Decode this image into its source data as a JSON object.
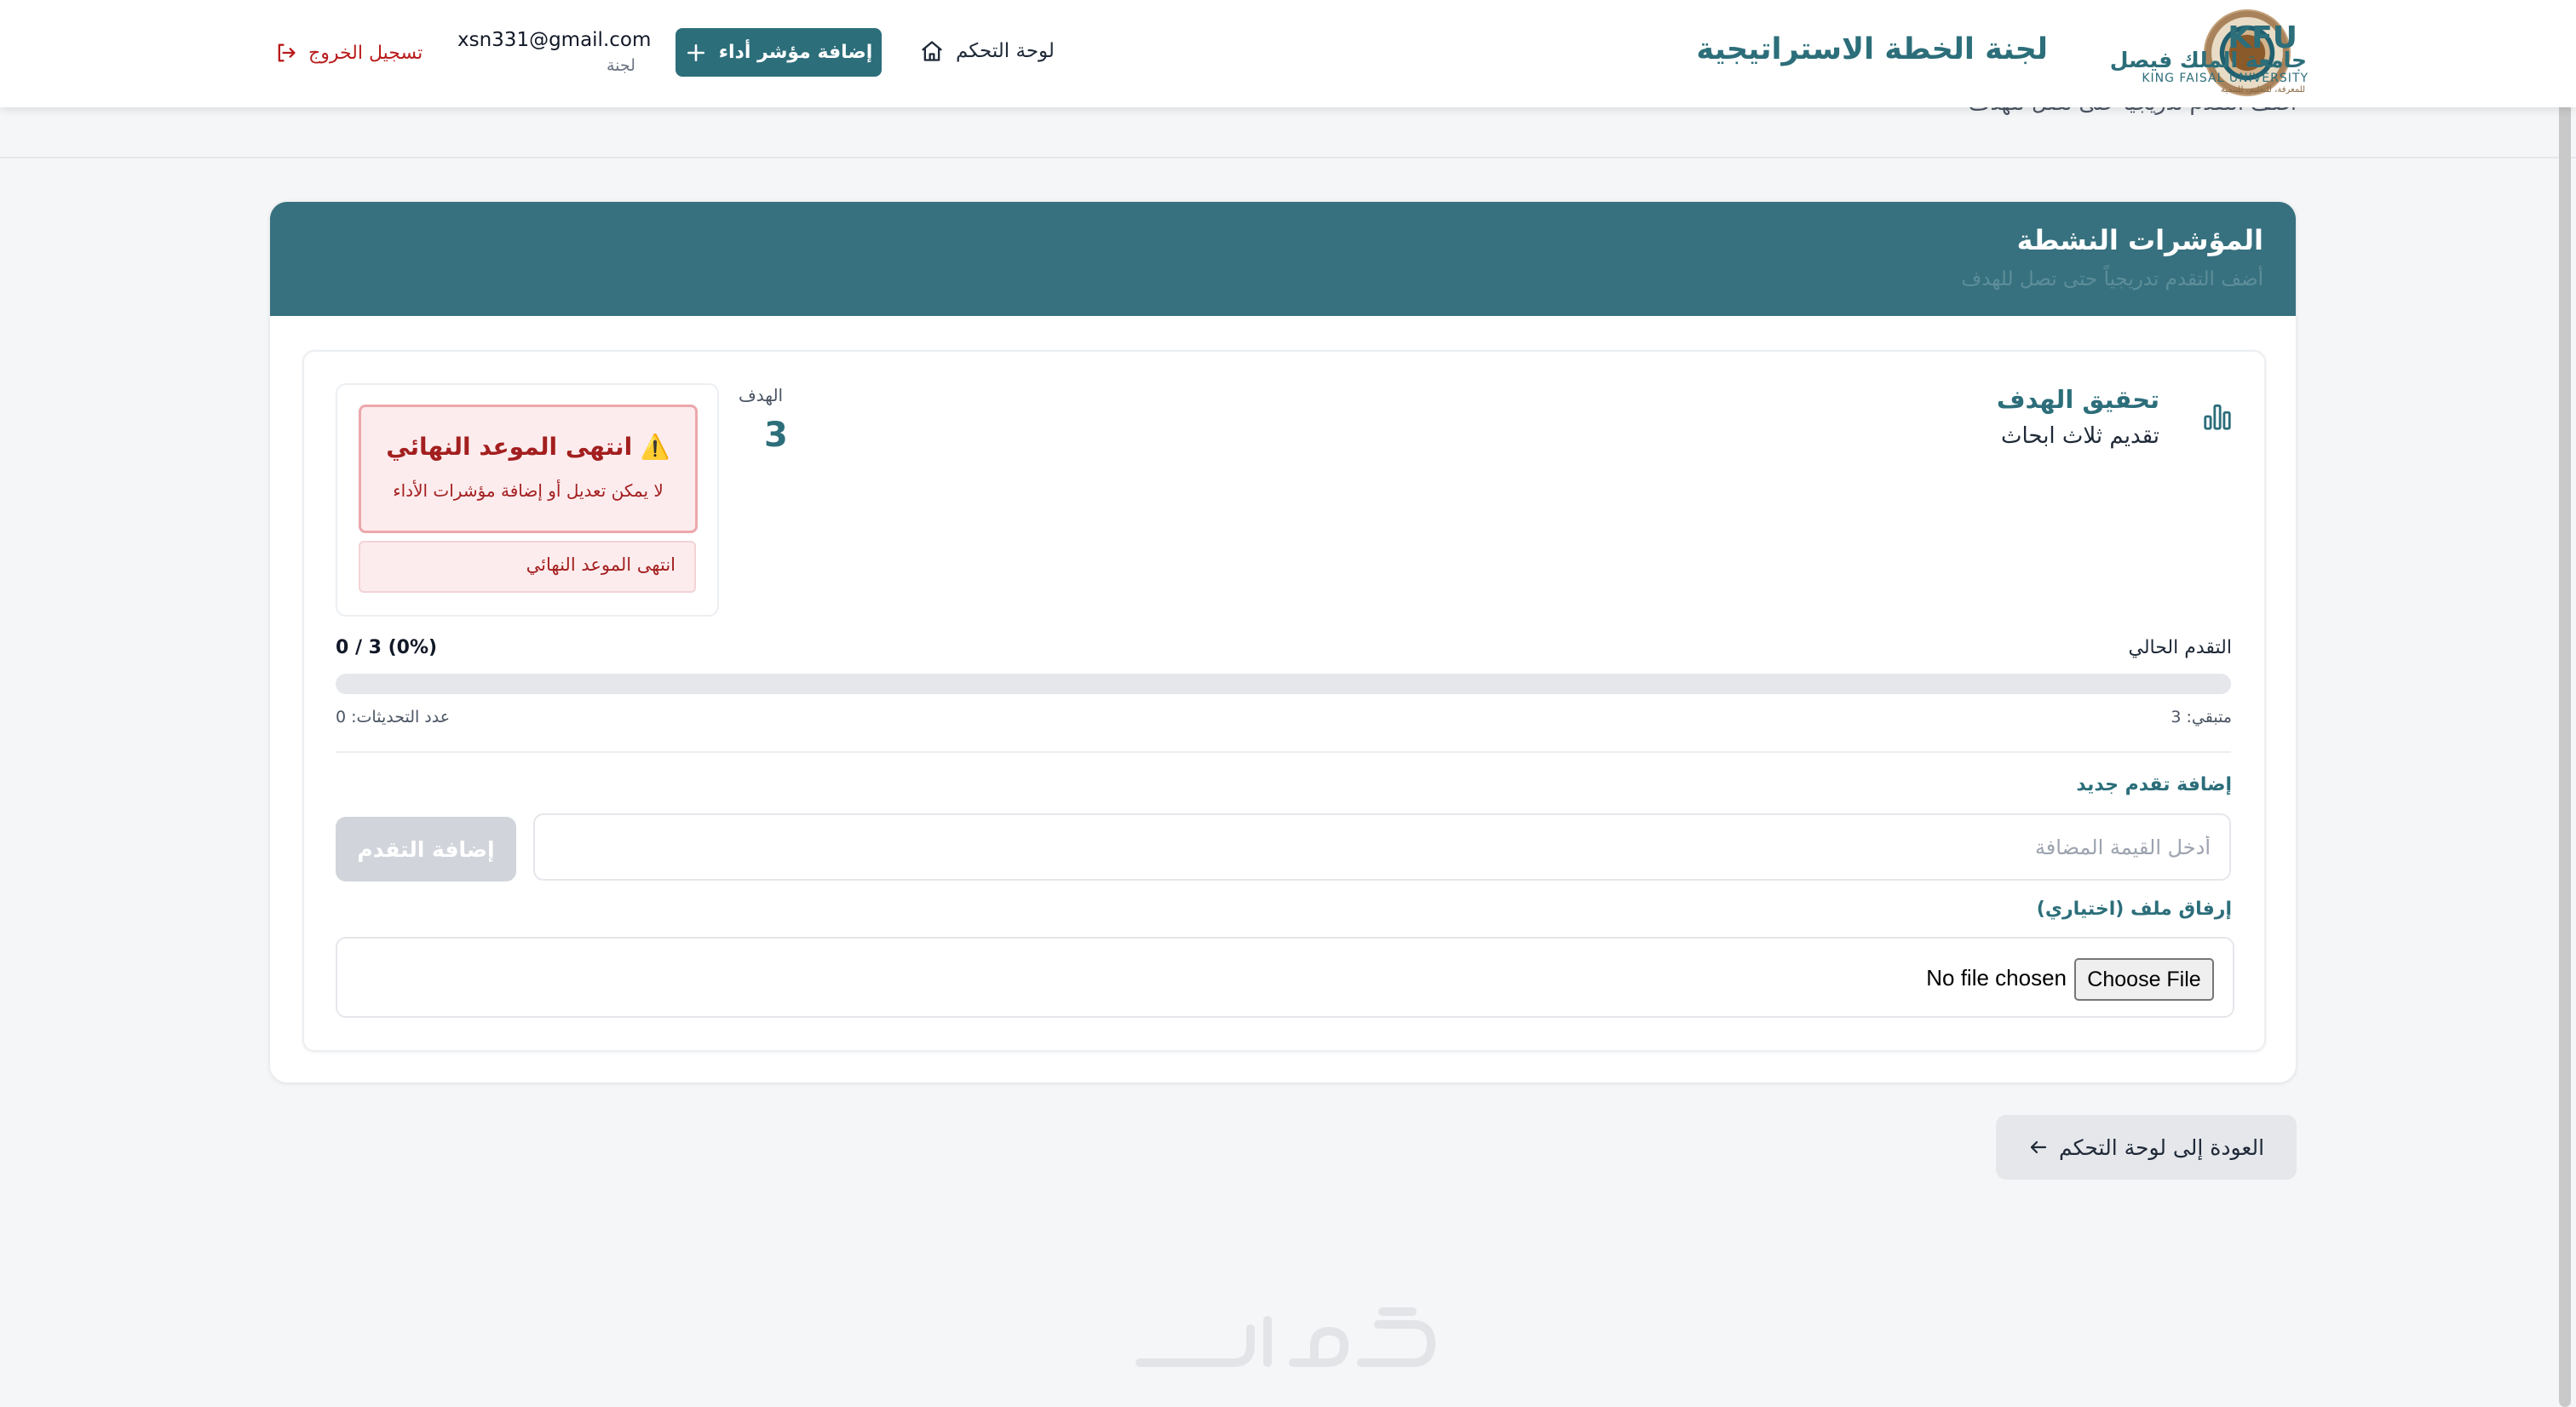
{
  "header": {
    "logo": {
      "kfu": "KFU",
      "arabic": "جامعة الملك فيصل",
      "english": "KING FAISAL UNIVERSITY",
      "tagline": "للمعرفة، للتعليم، للتنمية"
    },
    "app_title": "لجنة الخطة الاستراتيجية",
    "nav_dashboard": "لوحة التحكم",
    "add_kpi_button": "إضافة مؤشر أداء",
    "user_email": "xsn331@gmail.com",
    "user_role": "لجنة",
    "logout": "تسجيل الخروج"
  },
  "background": {
    "back_text": "أضف التقدم تدريجيا حتى تصل للهدف"
  },
  "card": {
    "title": "المؤشرات النشطة",
    "subtitle": "أضف التقدم تدريجياً حتى تصل للهدف"
  },
  "kpi": {
    "goal_title": "تحقيق الهدف",
    "goal_description": "تقديم ثلاث ابحاث",
    "target_label": "الهدف",
    "target_value": "3",
    "deadline_title": "⚠️ انتهى الموعد النهائي",
    "deadline_message": "لا يمكن تعديل أو إضافة مؤشرات الأداء",
    "deadline_status": "انتهى الموعد النهائي",
    "progress_label": "التقدم الحالي",
    "progress_ratio": "0 / 3 (0%)",
    "progress_fraction": 0,
    "remaining": "متبقي: 3",
    "updates_count": "عدد التحديثات: 0"
  },
  "form": {
    "add_progress_label": "إضافة تقدم جديد",
    "input_placeholder": "أدخل القيمة المضافة",
    "add_progress_button": "إضافة التقدم",
    "attach_label": "إرفاق ملف (اختياري)",
    "choose_file": "Choose File",
    "no_file": "No file chosen"
  },
  "back_button": "العودة إلى لوحة التحكم",
  "colors": {
    "primary": "#2c6e7a",
    "card_header": "#37717f",
    "danger": "#a31f1f",
    "danger_bg": "#fdecee"
  }
}
